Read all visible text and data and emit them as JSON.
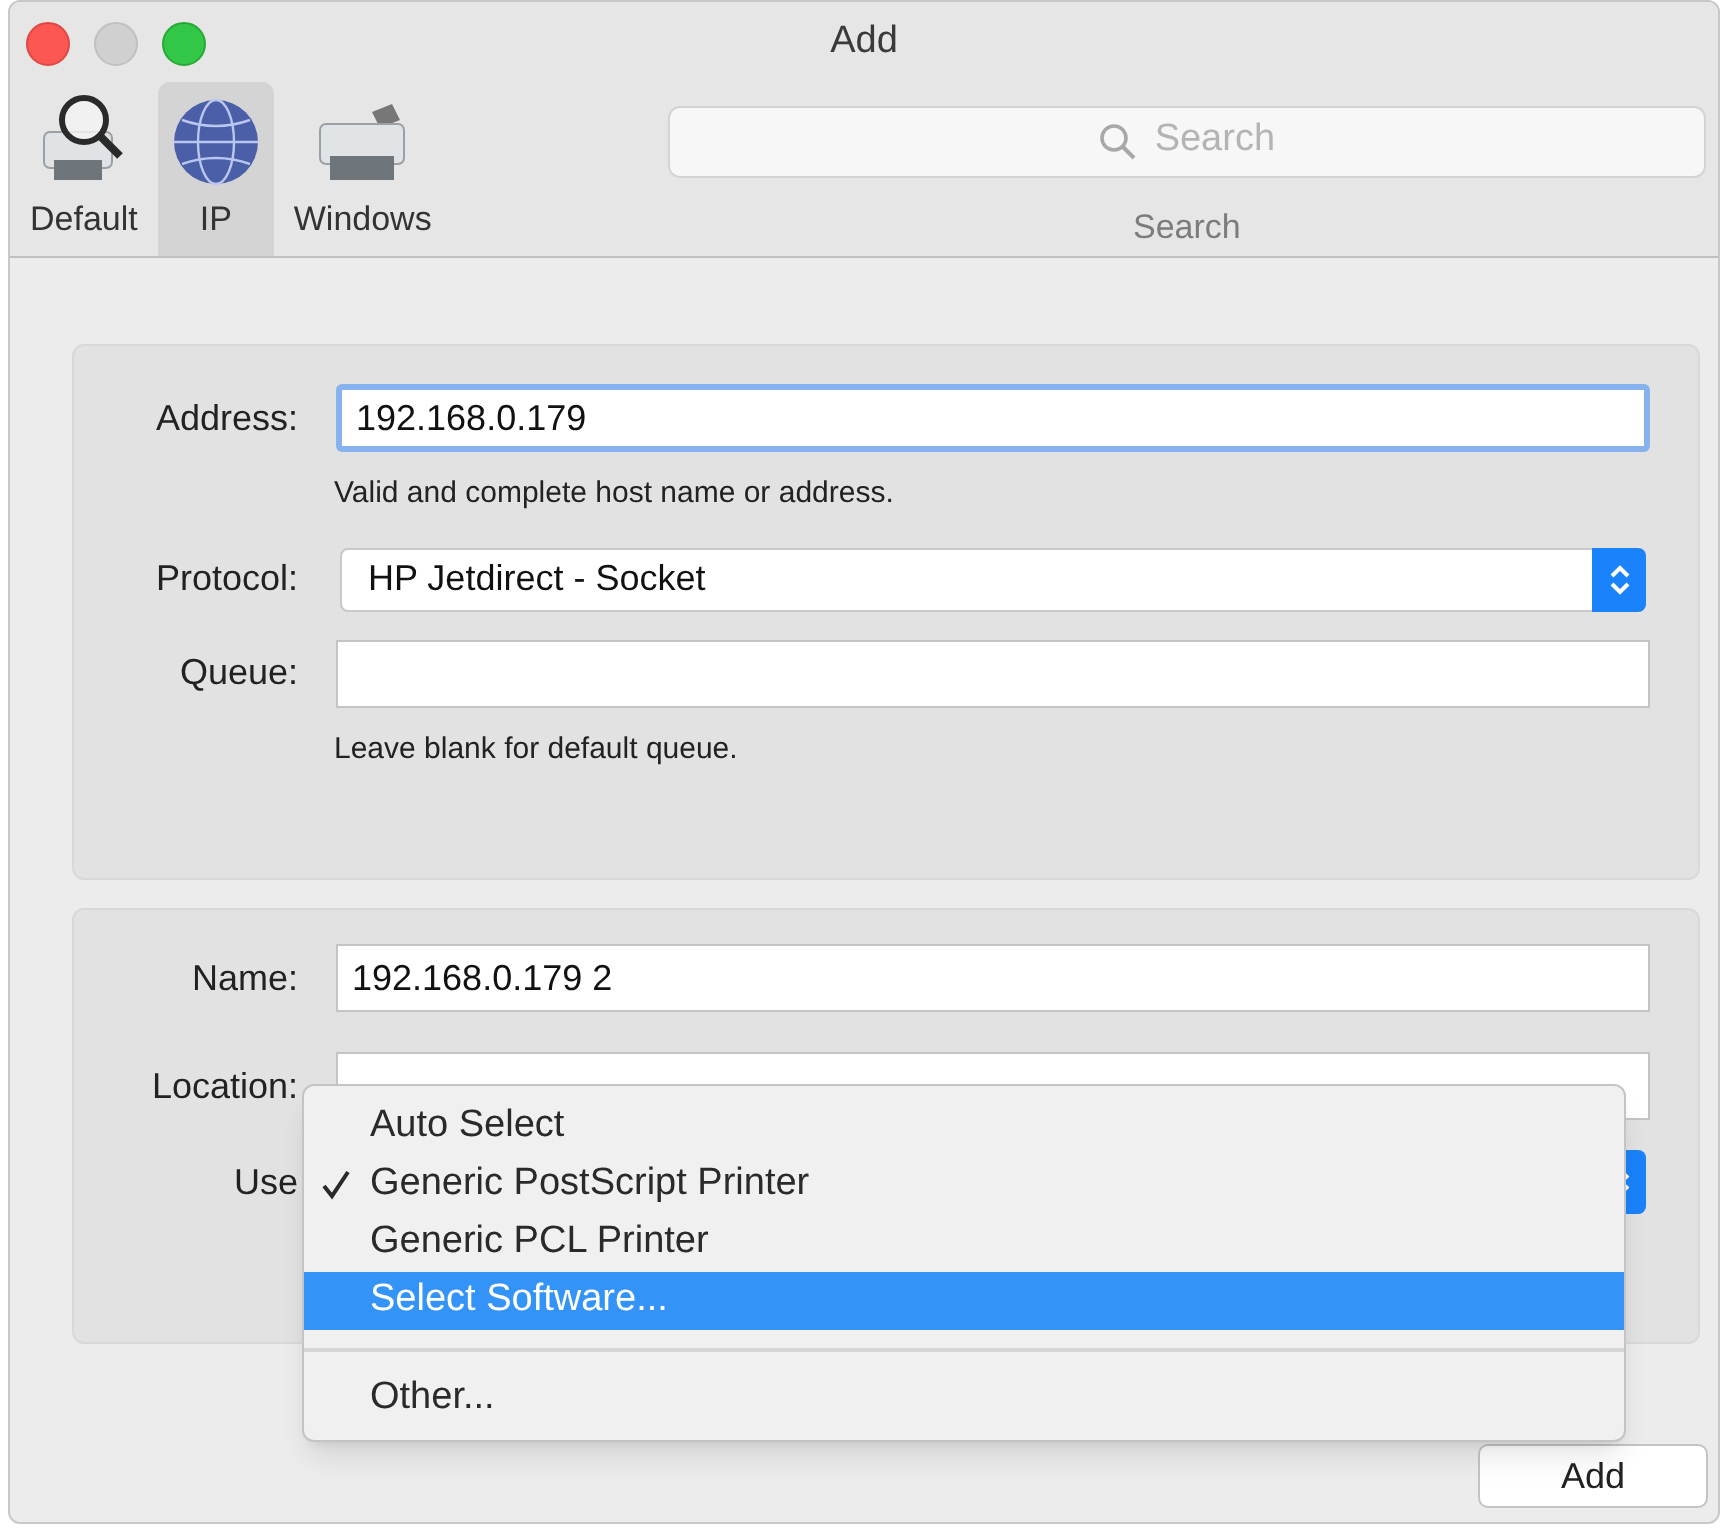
{
  "window": {
    "title": "Add"
  },
  "toolbar": {
    "tabs": [
      {
        "label": "Default",
        "kind": "default",
        "selected": false
      },
      {
        "label": "IP",
        "kind": "ip",
        "selected": true
      },
      {
        "label": "Windows",
        "kind": "windows",
        "selected": false
      }
    ],
    "search": {
      "placeholder": "Search",
      "label": "Search"
    }
  },
  "address_panel": {
    "fields": [
      {
        "label": "Address:",
        "kind": "text",
        "value": "192.168.0.179",
        "focused": true,
        "hint": "Valid and complete host name or address."
      },
      {
        "label": "Protocol:",
        "kind": "popup",
        "value": "HP Jetdirect - Socket"
      },
      {
        "label": "Queue:",
        "kind": "text",
        "focused": false,
        "hint": "Leave blank for default queue."
      }
    ]
  },
  "printer_panel": {
    "fields": [
      {
        "label": "Name:",
        "kind": "text",
        "value": "192.168.0.179 2",
        "focused": false
      },
      {
        "label": "Location:",
        "kind": "text",
        "focused": false
      },
      {
        "label": "Use",
        "kind": "popup"
      }
    ]
  },
  "popup_menu": {
    "items": [
      {
        "kind": "item",
        "label": "Auto Select",
        "checked": false,
        "selected": false
      },
      {
        "kind": "item",
        "label": "Generic PostScript Printer",
        "checked": true,
        "selected": false
      },
      {
        "kind": "item",
        "label": "Generic PCL Printer",
        "checked": false,
        "selected": false
      },
      {
        "kind": "item",
        "label": "Select Software...",
        "checked": false,
        "selected": true
      },
      {
        "kind": "separator"
      },
      {
        "kind": "item",
        "label": "Other...",
        "checked": false,
        "selected": false
      }
    ]
  },
  "buttons": [
    {
      "label": "Add"
    }
  ]
}
